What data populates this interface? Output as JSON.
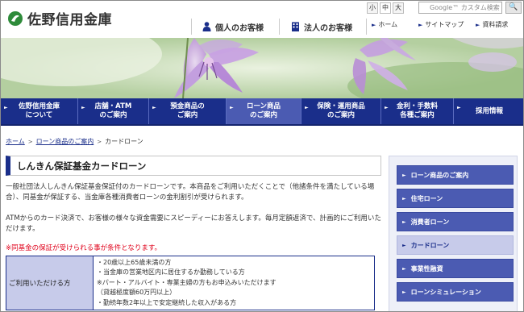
{
  "header": {
    "logo_text": "佐野信用金庫",
    "font_size": {
      "small": "小",
      "medium": "中",
      "large": "大"
    },
    "search_placeholder": "Google™ カスタム検索",
    "search_button": "🔍",
    "personal": "個人のお客様",
    "corporate": "法人のお客様",
    "home": "ホーム",
    "sitemap": "サイトマップ",
    "request": "資料請求"
  },
  "nav": [
    {
      "line1": "佐野信用金庫",
      "line2": "について"
    },
    {
      "line1": "店舗・ATM",
      "line2": "のご案内"
    },
    {
      "line1": "預金商品の",
      "line2": "ご案内"
    },
    {
      "line1": "ローン商品",
      "line2": "のご案内"
    },
    {
      "line1": "保険・運用商品",
      "line2": "のご案内"
    },
    {
      "line1": "金利・手数料",
      "line2": "各種ご案内"
    },
    {
      "line1": "採用情報",
      "line2": ""
    }
  ],
  "breadcrumb": {
    "home": "ホーム",
    "loan": "ローン商品のご案内",
    "current": "カードローン"
  },
  "main": {
    "title": "しんきん保証基金カードローン",
    "para1": "一般社団法人しんきん保証基金保証付のカードローンです。本商品をご利用いただくことで（他諸条件を満たしている場合）、同基金が保証する、当金庫各種消費者ローンの金利割引が受けられます。",
    "para2": "ATMからのカード決済で、お客様の様々な資金需要にスピーディーにお答えします。毎月定額返済で、計画的にご利用いただけます。",
    "warning": "※同基金の保証が受けられる事が条件となります。",
    "table_head": "ご利用いただける方",
    "table_lines": [
      "・20歳以上65歳未満の方",
      "・当金庫の営業地区内に居住するか勤務している方",
      "※パート・アルバイト・専業主婦の方もお申込みいただけます",
      "（貸越極度額60万円以上）",
      "・勤続年数2年以上で安定継続した収入がある方"
    ]
  },
  "sidebar": [
    "ローン商品のご案内",
    "住宅ローン",
    "消費者ローン",
    "カードローン",
    "事業性融資",
    "ローンシミュレーション"
  ],
  "colors": {
    "nav_bg": "#1a2e8a",
    "nav_active": "#4b5bb2",
    "sidebar_active": "#c7cbea",
    "warning": "#e0001a",
    "logo_green": "#2e8b3a"
  },
  "icons": [
    "logo-icon",
    "person-icon",
    "building-icon",
    "arrow-right-icon",
    "search-icon"
  ]
}
